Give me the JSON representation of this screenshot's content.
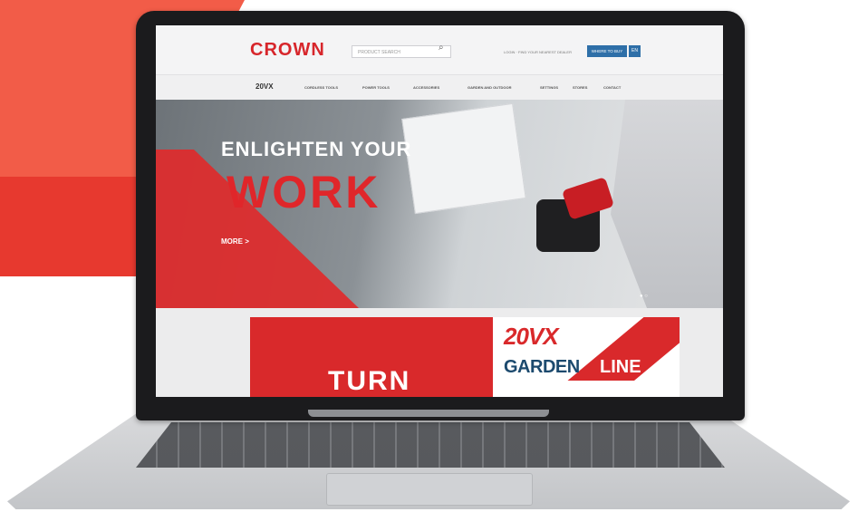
{
  "site": {
    "brand": "CROWN",
    "search_placeholder": "PRODUCT SEARCH",
    "top_links": "LOGIN  ·  FIND YOUR NEAREST DEALER",
    "cta_button": "WHERE TO BUY",
    "cta_small": "EN"
  },
  "nav": {
    "logo": "20VX",
    "items": [
      "CORDLESS TOOLS",
      "POWER TOOLS",
      "ACCESSORIES",
      "GARDEN AND OUTDOOR",
      "SETTINGS",
      "STORES",
      "CONTACT"
    ]
  },
  "hero": {
    "line1": "ENLIGHTEN YOUR",
    "line2": "WORK",
    "more": "MORE >"
  },
  "promos": {
    "left_text": "TURN",
    "right_mark": "20VX",
    "right_line1": "GARDEN",
    "right_line2": "LINE"
  },
  "colors": {
    "brand_red": "#d9292b",
    "button_blue": "#2e6fa8",
    "promo_blue": "#1c4a6e"
  },
  "icons": [
    "search-icon",
    "chevron-right-icon"
  ]
}
